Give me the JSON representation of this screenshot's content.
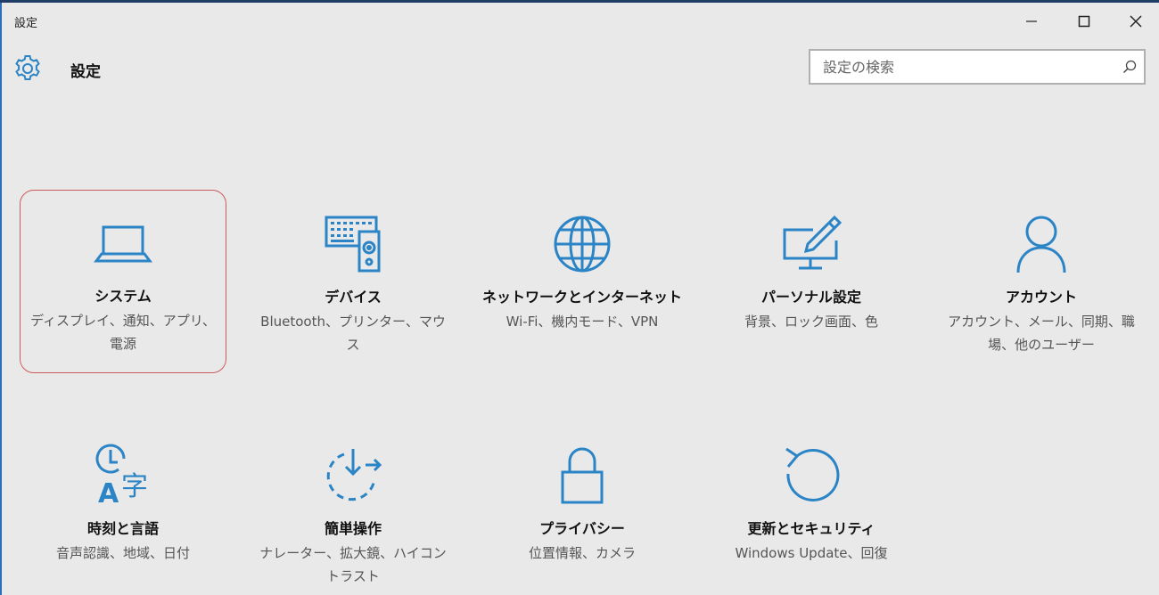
{
  "window": {
    "title": "設定"
  },
  "header": {
    "title": "設定",
    "search_placeholder": "設定の検索"
  },
  "tiles": [
    {
      "title": "システム",
      "desc": "ディスプレイ、通知、アプリ、電源",
      "icon": "laptop-icon"
    },
    {
      "title": "デバイス",
      "desc": "Bluetooth、プリンター、マウス",
      "icon": "devices-icon"
    },
    {
      "title": "ネットワークとインターネット",
      "desc": "Wi-Fi、機内モード、VPN",
      "icon": "globe-icon"
    },
    {
      "title": "パーソナル設定",
      "desc": "背景、ロック画面、色",
      "icon": "personalization-icon"
    },
    {
      "title": "アカウント",
      "desc": "アカウント、メール、同期、職場、他のユーザー",
      "icon": "person-icon"
    },
    {
      "title": "時刻と言語",
      "desc": "音声認識、地域、日付",
      "icon": "time-language-icon"
    },
    {
      "title": "簡単操作",
      "desc": "ナレーター、拡大鏡、ハイコントラスト",
      "icon": "ease-of-access-icon"
    },
    {
      "title": "プライバシー",
      "desc": "位置情報、カメラ",
      "icon": "lock-icon"
    },
    {
      "title": "更新とセキュリティ",
      "desc": "Windows Update、回復",
      "icon": "update-icon"
    }
  ],
  "colors": {
    "accent": "#2a84c6",
    "highlight_border": "#cc5a5a",
    "background": "#e9e9e9"
  }
}
